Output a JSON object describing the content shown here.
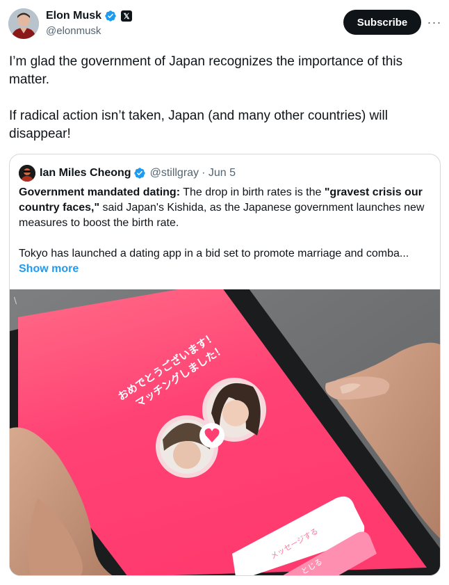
{
  "author": {
    "name": "Elon Musk",
    "handle": "@elonmusk",
    "x_badge": "𝕏"
  },
  "actions": {
    "subscribe_label": "Subscribe",
    "more_label": "···"
  },
  "tweet": {
    "paragraphs": [
      "I’m glad the government of Japan recognizes the importance of this matter.",
      "If radical action isn’t taken, Japan (and many other countries) will disappear!"
    ]
  },
  "quote": {
    "name": "Ian Miles Cheong",
    "handle": "@stillgray",
    "date": "· Jun 5",
    "lead_bold": "Government mandated dating:",
    "text_1": " The drop in birth rates is the ",
    "quote_bold": "\"gravest crisis our country faces,\"",
    "text_2": " said Japan's Kishida, as the Japanese government launches new measures to boost the birth rate.",
    "text_3": "Tokyo has launched a dating app in a bid set to promote marriage and comba...",
    "show_more": "Show more"
  },
  "photo": {
    "congrats_line1": "おめでとうございます！",
    "congrats_line2": "マッチングしました！",
    "message_button": "メッセージする",
    "close_button": "とじる"
  },
  "colors": {
    "accent": "#1d9bf0",
    "text": "#0f1419",
    "muted": "#536471",
    "border": "#cfd9de",
    "app_pink": "#ff3f72"
  }
}
